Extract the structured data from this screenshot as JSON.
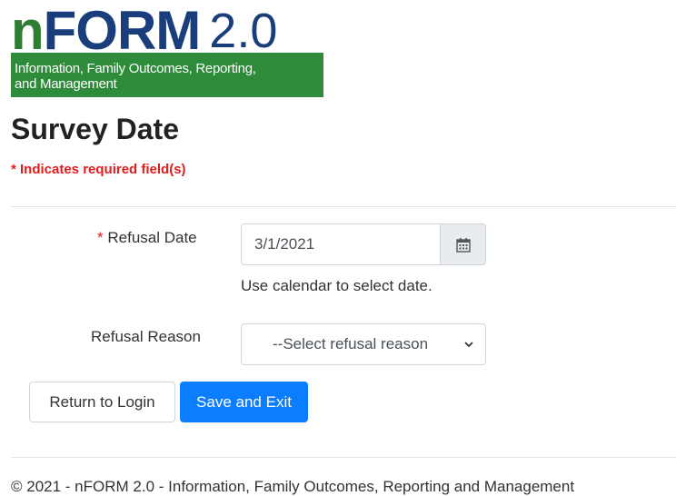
{
  "logo": {
    "letter_n": "n",
    "word": "FORM",
    "version": "2.0",
    "tagline_line1": "Information, Family Outcomes, Reporting,",
    "tagline_line2": "and Management",
    "colors": {
      "green": "#2e8b3a",
      "navy": "#1a3d7c"
    }
  },
  "page": {
    "title": "Survey Date",
    "required_note": "* Indicates required field(s)"
  },
  "form": {
    "refusal_date": {
      "required_marker": "*",
      "label": "Refusal Date",
      "value": "3/1/2021",
      "icon": "calendar-icon",
      "help_text": "Use calendar to select date."
    },
    "refusal_reason": {
      "label": "Refusal Reason",
      "selected": "--Select refusal reason",
      "icon": "chevron-down-icon"
    }
  },
  "buttons": {
    "return_login": "Return to Login",
    "save_exit": "Save and Exit"
  },
  "footer": {
    "text": "© 2021 - nFORM 2.0 - Information, Family Outcomes, Reporting and Management"
  },
  "colors": {
    "required": "#e31b1b",
    "primary": "#0b7dff"
  }
}
